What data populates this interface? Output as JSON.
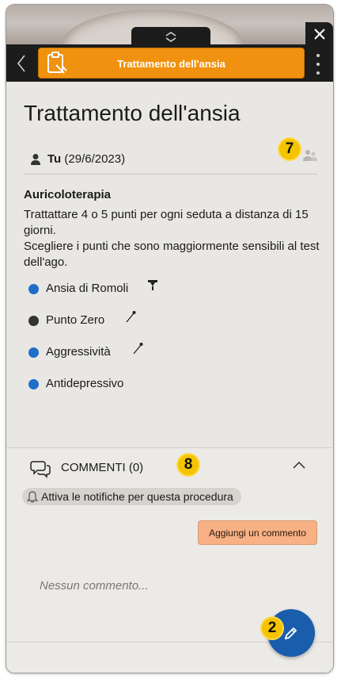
{
  "header": {
    "title_label": "Trattamento dell'ansia"
  },
  "page": {
    "title": "Trattamento dell'ansia",
    "author_name": "Tu",
    "author_date": "(29/6/2023)"
  },
  "badges": {
    "b7": "7",
    "b8": "8",
    "b2": "2"
  },
  "section": {
    "title": "Auricoloterapia",
    "lines": [
      "Trattattare 4 o 5 punti per ogni seduta a distanza di 15 giorni.",
      "Scegliere i punti che sono maggiormente sensibili al test dell'ago."
    ]
  },
  "points": [
    {
      "label": "Ansia di Romoli",
      "dot_color": "#1e6fc8",
      "tool_icon": "tack-icon"
    },
    {
      "label": "Punto Zero",
      "dot_color": "#333333",
      "tool_icon": "needle-icon"
    },
    {
      "label": "Aggressività",
      "dot_color": "#1e6fc8",
      "tool_icon": "needle-icon"
    },
    {
      "label": "Antidepressivo",
      "dot_color": "#1e6fc8",
      "tool_icon": ""
    }
  ],
  "comments": {
    "header_label": "COMMENTI (0)",
    "notify_label": "Attiva le notifiche per questa procedura",
    "add_button_label": "Aggiungi un commento",
    "empty_label": "Nessun commento..."
  },
  "colors": {
    "accent": "#f0920f",
    "fab": "#1a5dad",
    "badge": "#f5c400",
    "add_button": "#f7b184"
  }
}
